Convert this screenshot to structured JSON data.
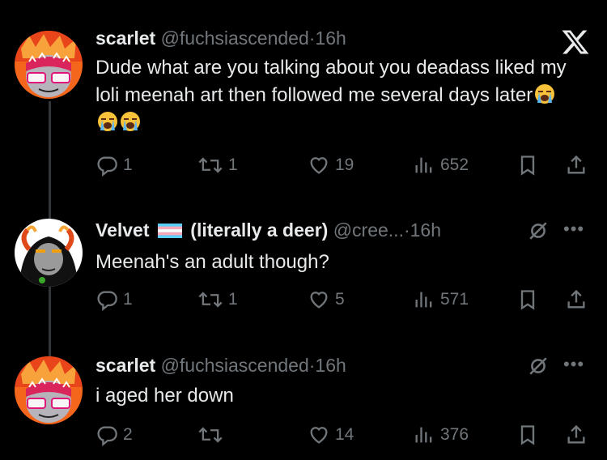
{
  "tweets": [
    {
      "name": "scarlet",
      "handle": "@fuchsiascended",
      "dot": "·",
      "time": "16h",
      "text": "Dude what are you talking about you deadass liked my loli meenah art then followed me several days later",
      "emoji": [
        "loudly-crying-face",
        "loudly-crying-face",
        "loudly-crying-face"
      ],
      "replies": "1",
      "reposts": "1",
      "likes": "19",
      "views": "652"
    },
    {
      "name": "Velvet",
      "flag": "transgender-flag",
      "name_suffix": "(literally a deer)",
      "handle": "@cree...",
      "dot": "·",
      "time": "16h",
      "text": "Meenah's an adult though?",
      "replies": "1",
      "reposts": "1",
      "likes": "5",
      "views": "571"
    },
    {
      "name": "scarlet",
      "handle": "@fuchsiascended",
      "dot": "·",
      "time": "16h",
      "text": "i aged her down",
      "replies": "2",
      "reposts": "",
      "likes": "14",
      "views": "376"
    }
  ],
  "icons": {
    "close": "x-logo-icon",
    "reply": "reply-icon",
    "repost": "repost-icon",
    "like": "heart-icon",
    "views": "views-icon",
    "bookmark": "bookmark-icon",
    "share": "share-icon",
    "mute": "mute-icon",
    "more": "more-icon"
  },
  "colors": {
    "background": "#000000",
    "text": "#e7e9ea",
    "muted": "#71767b"
  }
}
